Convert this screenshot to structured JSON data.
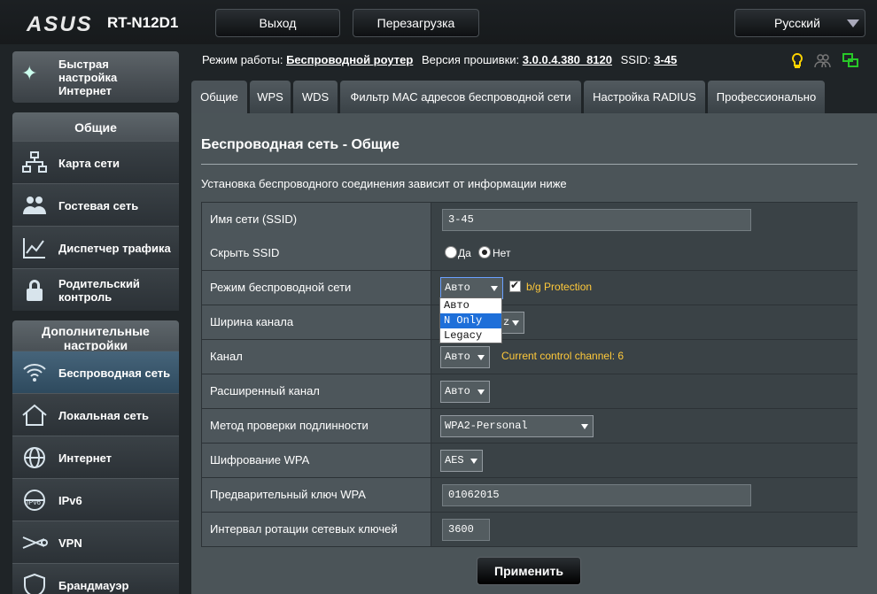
{
  "header": {
    "brand": "ASUS",
    "model": "RT-N12D1",
    "logout_label": "Выход",
    "reboot_label": "Перезагрузка",
    "language": "Русский"
  },
  "sidebar": {
    "quick_setup": "Быстрая настройка Интернет",
    "general_heading": "Общие",
    "general_items": [
      {
        "label": "Карта сети",
        "icon": "network-map-icon"
      },
      {
        "label": "Гостевая сеть",
        "icon": "guest-network-icon"
      },
      {
        "label": "Диспетчер трафика",
        "icon": "traffic-manager-icon"
      },
      {
        "label": "Родительский контроль",
        "icon": "parental-lock-icon"
      }
    ],
    "advanced_heading": "Дополнительные настройки",
    "advanced_items": [
      {
        "label": "Беспроводная сеть",
        "icon": "wifi-icon",
        "active": true
      },
      {
        "label": "Локальная сеть",
        "icon": "home-icon"
      },
      {
        "label": "Интернет",
        "icon": "globe-icon"
      },
      {
        "label": "IPv6",
        "icon": "ipv6-globe-icon"
      },
      {
        "label": "VPN",
        "icon": "vpn-icon"
      },
      {
        "label": "Брандмауэр",
        "icon": "firewall-shield-icon"
      }
    ]
  },
  "status": {
    "mode_label": "Режим работы:",
    "mode_value": "Беспроводной роутер",
    "firmware_label": "Версия прошивки:",
    "firmware_value": "3.0.0.4.380_8120",
    "ssid_label": "SSID:",
    "ssid_value": "3-45"
  },
  "tabs": [
    {
      "label": "Общие",
      "active": true
    },
    {
      "label": "WPS"
    },
    {
      "label": "WDS"
    },
    {
      "label": "Фильтр MAC адресов беспроводной сети"
    },
    {
      "label": "Настройка RADIUS"
    },
    {
      "label": "Профессионально"
    }
  ],
  "main": {
    "title": "Беспроводная сеть - Общие",
    "description": "Установка беспроводного соединения зависит от информации ниже",
    "fields": {
      "ssid_label": "Имя сети (SSID)",
      "ssid_value": "3-45",
      "hide_ssid_label": "Скрыть SSID",
      "hide_yes": "Да",
      "hide_no": "Нет",
      "mode_label": "Режим беспроводной сети",
      "mode_value": "Авто",
      "bg_protection": "b/g Protection",
      "mode_options": [
        "Авто",
        "N Only",
        "Legacy"
      ],
      "width_label": "Ширина канала",
      "width_suffix": "z",
      "channel_label": "Канал",
      "channel_value": "Авто",
      "channel_note": "Current control channel: 6",
      "ext_channel_label": "Расширенный канал",
      "ext_channel_value": "Авто",
      "auth_label": "Метод проверки подлинности",
      "auth_value": "WPA2-Personal",
      "enc_label": "Шифрование WPA",
      "enc_value": "AES",
      "psk_label": "Предварительный ключ WPA",
      "psk_value": "01062015",
      "rotation_label": "Интервал ротации сетевых ключей",
      "rotation_value": "3600"
    },
    "apply_label": "Применить"
  }
}
